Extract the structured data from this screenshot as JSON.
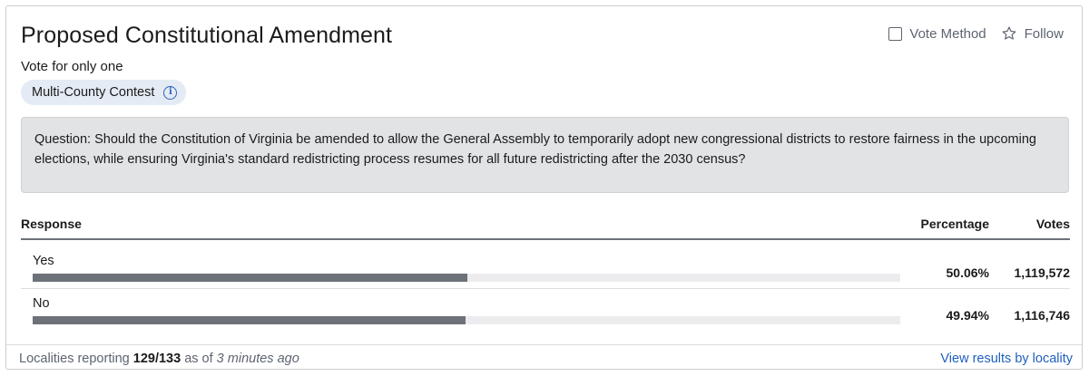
{
  "contest": {
    "title": "Proposed Constitutional Amendment",
    "instruction": "Vote for only one",
    "tag": "Multi-County Contest",
    "info_icon": "info-icon"
  },
  "actions": {
    "vote_method_label": "Vote Method",
    "vote_method_checked": false,
    "follow_label": "Follow",
    "follow_icon": "star-icon"
  },
  "question": "Question: Should the Constitution of Virginia be amended to allow the General Assembly to temporarily adopt new congressional districts to restore fairness in the upcoming elections, while ensuring Virginia's standard redistricting process resumes for all future redistricting after the 2030 census?",
  "table": {
    "headers": {
      "response": "Response",
      "percentage": "Percentage",
      "votes": "Votes"
    },
    "rows": [
      {
        "label": "Yes",
        "percentage": "50.06%",
        "votes": "1,119,572",
        "fraction": 0.5006
      },
      {
        "label": "No",
        "percentage": "49.94%",
        "votes": "1,116,746",
        "fraction": 0.4994
      }
    ]
  },
  "footer": {
    "prefix": "Localities reporting ",
    "reporting": "129/133",
    "middle": " as of ",
    "as_of": "3 minutes ago",
    "link": "View results by locality"
  },
  "colors": {
    "bar_fill": "#6d7178",
    "bar_track": "#ececee",
    "link": "#1f5fbf",
    "tag_bg": "#e4ebf5",
    "question_bg": "#e2e3e5"
  }
}
